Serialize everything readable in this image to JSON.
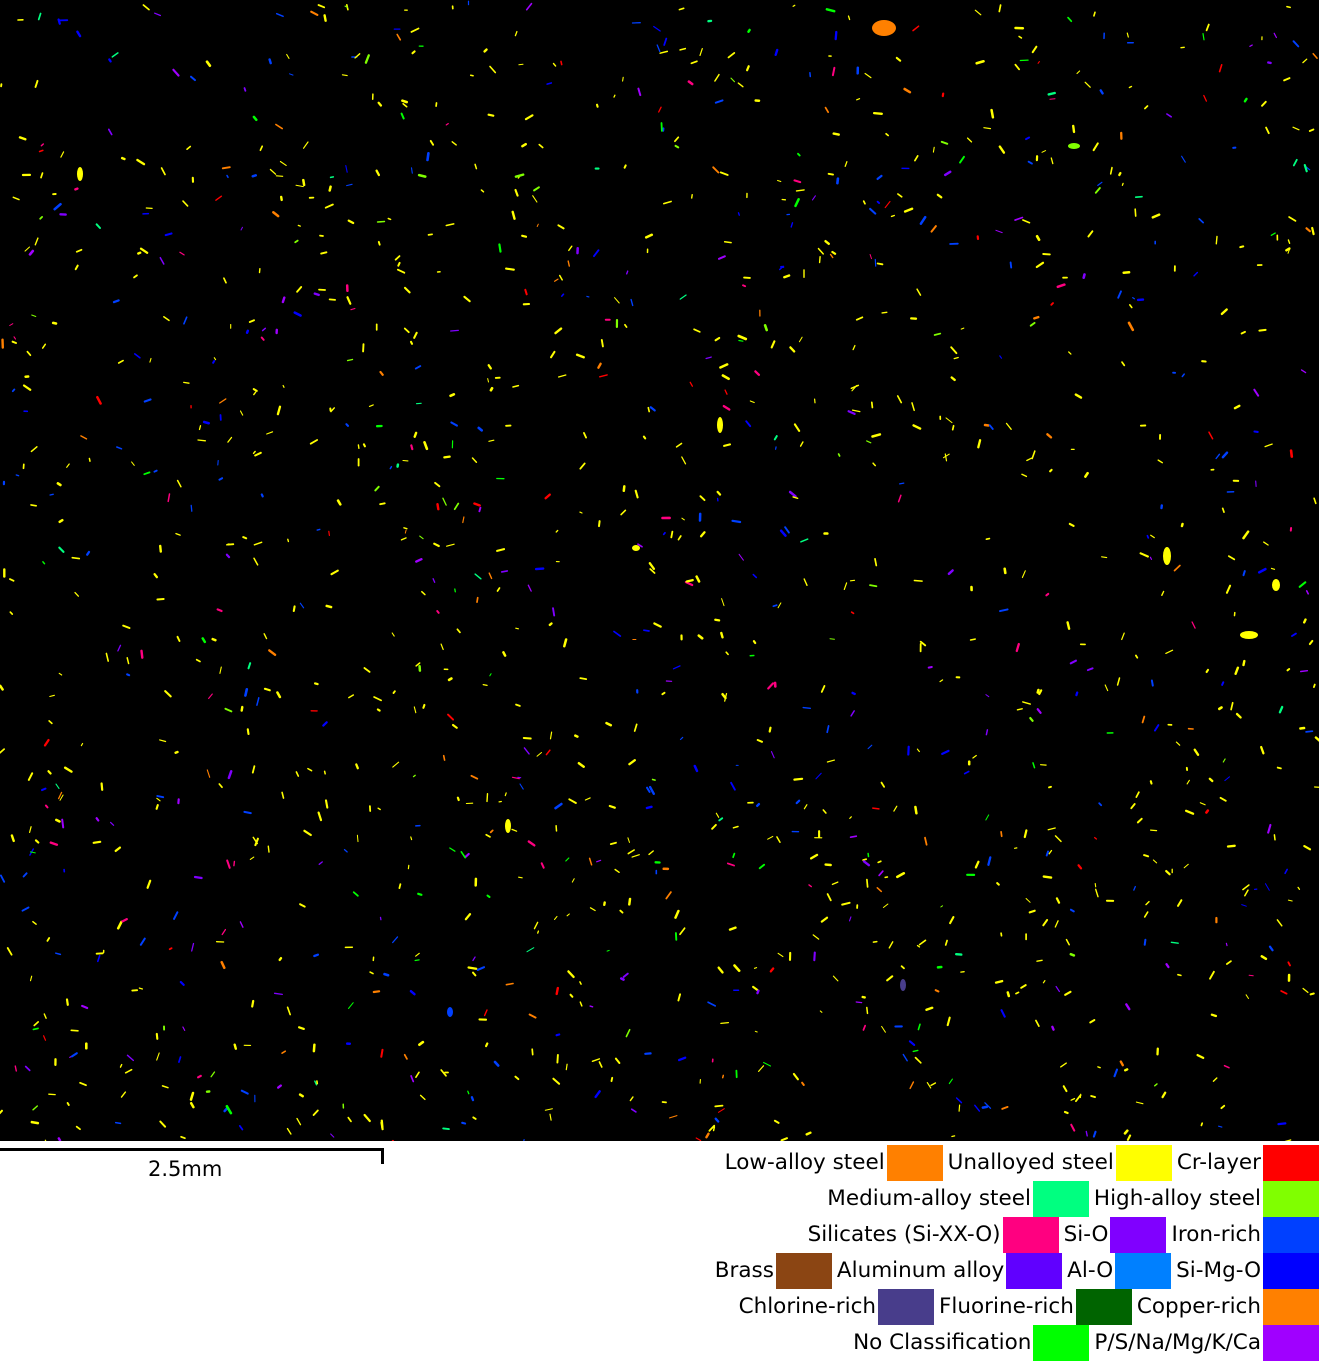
{
  "scale_bar": {
    "label": "2.5mm"
  },
  "legend": {
    "rows": [
      [
        {
          "label": "Low-alloy steel",
          "color": "#ff8000"
        },
        {
          "label": "Unalloyed steel",
          "color": "#ffff00"
        },
        {
          "label": "Cr-layer",
          "color": "#ff0000"
        }
      ],
      [
        {
          "label": "Medium-alloy steel",
          "color": "#00ff80"
        },
        {
          "label": "High-alloy steel",
          "color": "#80ff00"
        }
      ],
      [
        {
          "label": "Silicates (Si-XX-O)",
          "color": "#ff0080"
        },
        {
          "label": "Si-O",
          "color": "#8000ff"
        },
        {
          "label": "Iron-rich",
          "color": "#0040ff"
        }
      ],
      [
        {
          "label": "Brass",
          "color": "#8b4513"
        },
        {
          "label": "Aluminum alloy",
          "color": "#6000ff"
        },
        {
          "label": "Al-O",
          "color": "#0080ff"
        },
        {
          "label": "Si-Mg-O",
          "color": "#0000ff"
        }
      ],
      [
        {
          "label": "Chlorine-rich",
          "color": "#483d8b"
        },
        {
          "label": "Fluorine-rich",
          "color": "#006400"
        },
        {
          "label": "Copper-rich",
          "color": "#ff8000"
        }
      ],
      [
        {
          "label": "No Classification",
          "color": "#00ff00"
        },
        {
          "label": "P/S/Na/Mg/K/Ca",
          "color": "#a000ff"
        }
      ]
    ]
  }
}
